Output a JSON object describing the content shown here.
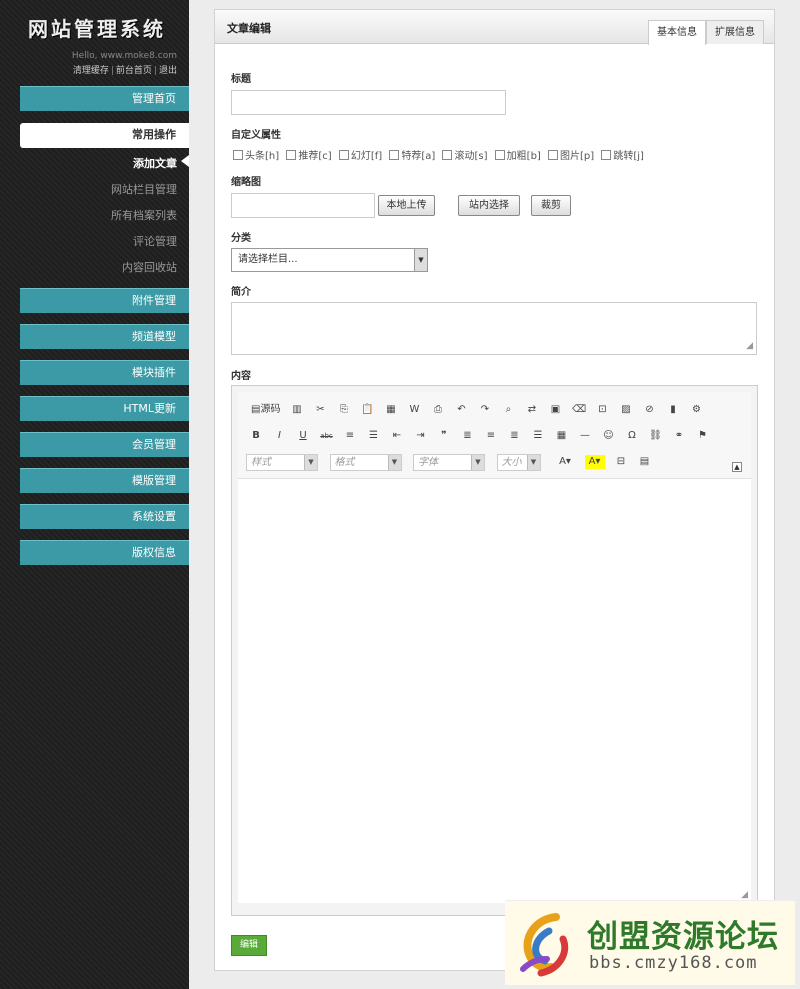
{
  "sidebar": {
    "logo": "网站管理系统",
    "hello": "Hello, www.moke8.com",
    "links": [
      "清理缓存",
      "前台首页",
      "退出"
    ],
    "nav": [
      "管理首页",
      "常用操作",
      "附件管理",
      "频道模型",
      "模块插件",
      "HTML更新",
      "会员管理",
      "模版管理",
      "系统设置",
      "版权信息"
    ],
    "subnav": [
      "添加文章",
      "网站栏目管理",
      "所有档案列表",
      "评论管理",
      "内容回收站"
    ]
  },
  "panel": {
    "title": "文章编辑",
    "tabs": [
      "基本信息",
      "扩展信息"
    ],
    "title_label": "标题",
    "attr_label": "自定义属性",
    "flags": [
      "头条[h]",
      "推荐[c]",
      "幻灯[f]",
      "特荐[a]",
      "滚动[s]",
      "加粗[b]",
      "图片[p]",
      "跳转[j]"
    ],
    "thumb_label": "缩略图",
    "upload_btn": "本地上传",
    "choose_btn": "站内选择",
    "crop_btn": "裁剪",
    "category_label": "分类",
    "category_value": "请选择栏目...",
    "summary_label": "简介",
    "content_label": "内容",
    "source_btn": "源码",
    "combos": [
      "样式",
      "格式",
      "字体",
      "大小"
    ],
    "submit": "编辑"
  },
  "watermark": {
    "title": "创盟资源论坛",
    "url": "bbs.cmzy168.com"
  }
}
